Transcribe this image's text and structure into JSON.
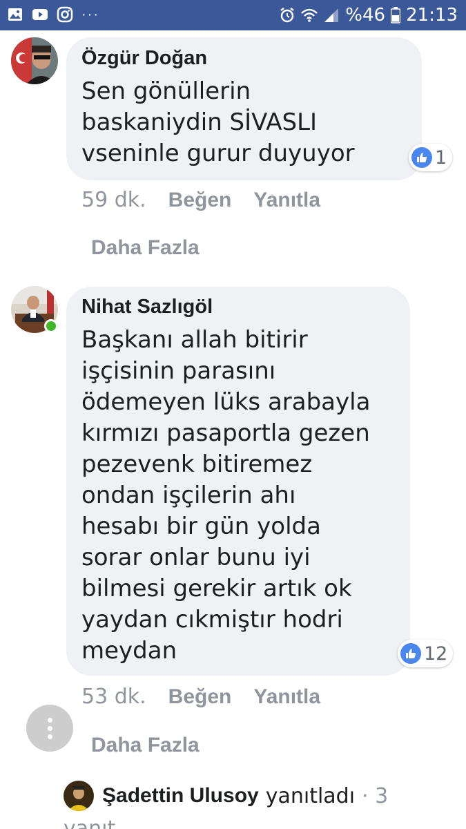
{
  "status_bar": {
    "battery": "%46",
    "time": "21:13",
    "dots": "···",
    "icons": [
      "gallery-icon",
      "youtube-icon",
      "instagram-icon",
      "alarm-icon",
      "wifi-icon",
      "signal-icon",
      "battery-icon"
    ],
    "bg_color": "#3b5998"
  },
  "comments": [
    {
      "author": "Özgür Doğan",
      "lines": [
        "Sen gönüllerin",
        "baskaniydin SİVASLI",
        "vseninle gurur duyuyor"
      ],
      "reaction_count": "1",
      "time": "59 dk.",
      "like_label": "Beğen",
      "reply_label": "Yanıtla",
      "more_label": "Daha Fazla"
    },
    {
      "author": "Nihat Sazlıgöl",
      "online": true,
      "lines": [
        "Başkanı allah bitirir",
        "işçisinin parasını",
        "ödemeyen lüks arabayla",
        "kırmızı pasaportla gezen",
        "pezevenk bitiremez",
        "ondan işçilerin ahı",
        "hesabı bir gün yolda",
        "sorar onlar bunu iyi",
        "bilmesi gerekir artık ok",
        "yaydan cıkmiştır hodri",
        "meydan"
      ],
      "reaction_count": "12",
      "time": "53 dk.",
      "like_label": "Beğen",
      "reply_label": "Yanıtla",
      "more_label": "Daha Fazla"
    }
  ],
  "reply_summary": {
    "name": "Şadettin Ulusoy",
    "verb": "yanıtladı",
    "count": "· 3",
    "cut_text": "yanıt"
  },
  "colors": {
    "bubble": "#f0f1f4",
    "like_blue": "#4a86f0",
    "meta_gray": "#90949c",
    "online_green": "#42b72a"
  }
}
